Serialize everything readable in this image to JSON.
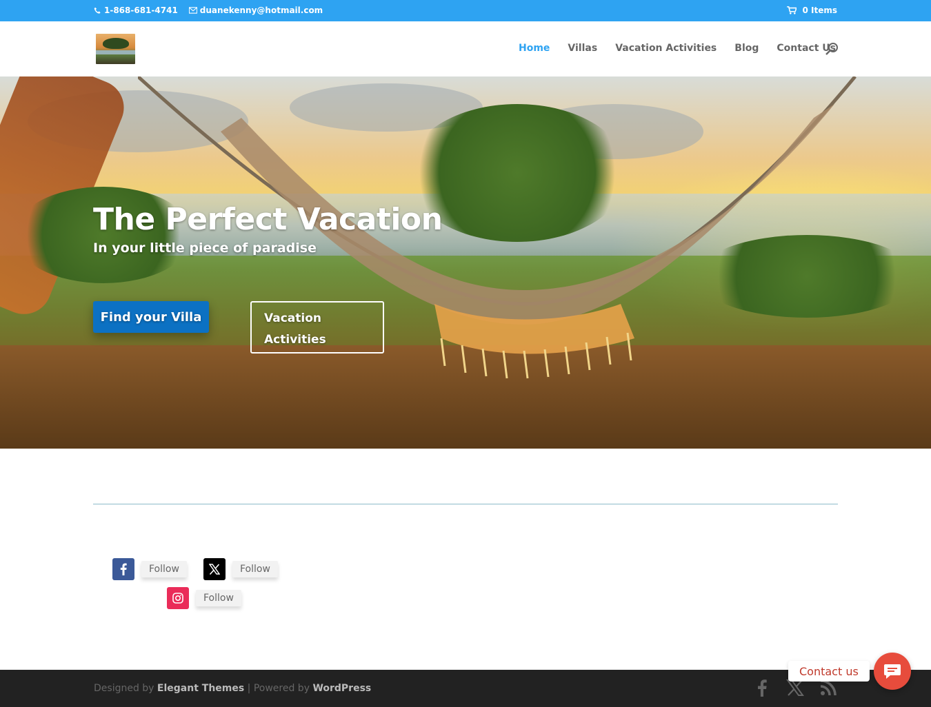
{
  "topbar": {
    "phone": "1-868-681-4741",
    "email": "duanekenny@hotmail.com",
    "cart": "0 Items",
    "phone_icon": "phone-icon",
    "email_icon": "envelope-icon",
    "cart_icon": "cart-icon"
  },
  "header": {
    "nav": [
      {
        "label": "Home",
        "active": true
      },
      {
        "label": "Villas"
      },
      {
        "label": "Vacation Activities"
      },
      {
        "label": "Blog"
      },
      {
        "label": "Contact Us"
      }
    ],
    "search_icon": "search-icon"
  },
  "hero": {
    "title": "The Perfect Vacation",
    "subtitle": "In your little piece of paradise",
    "primary_button": "Find your Villa",
    "secondary_button": "Vacation Activities"
  },
  "social": {
    "items": [
      {
        "network": "facebook",
        "label": "Follow",
        "color": "#3b5998"
      },
      {
        "network": "x",
        "label": "Follow",
        "color": "#000000"
      },
      {
        "network": "instagram",
        "label": "Follow",
        "color": "#ea2c59"
      }
    ]
  },
  "footer": {
    "designed_by": "Designed by",
    "theme_author": "Elegant Themes",
    "separator": "| Powered by",
    "platform": "WordPress",
    "icons": [
      "facebook-icon",
      "x-icon",
      "rss-icon"
    ]
  },
  "contact_widget": {
    "label": "Contact us",
    "color": "#e74c3c"
  },
  "colors": {
    "accent": "#2ea3f2",
    "button_blue": "#0c71c3",
    "footer_bg": "#222222"
  }
}
